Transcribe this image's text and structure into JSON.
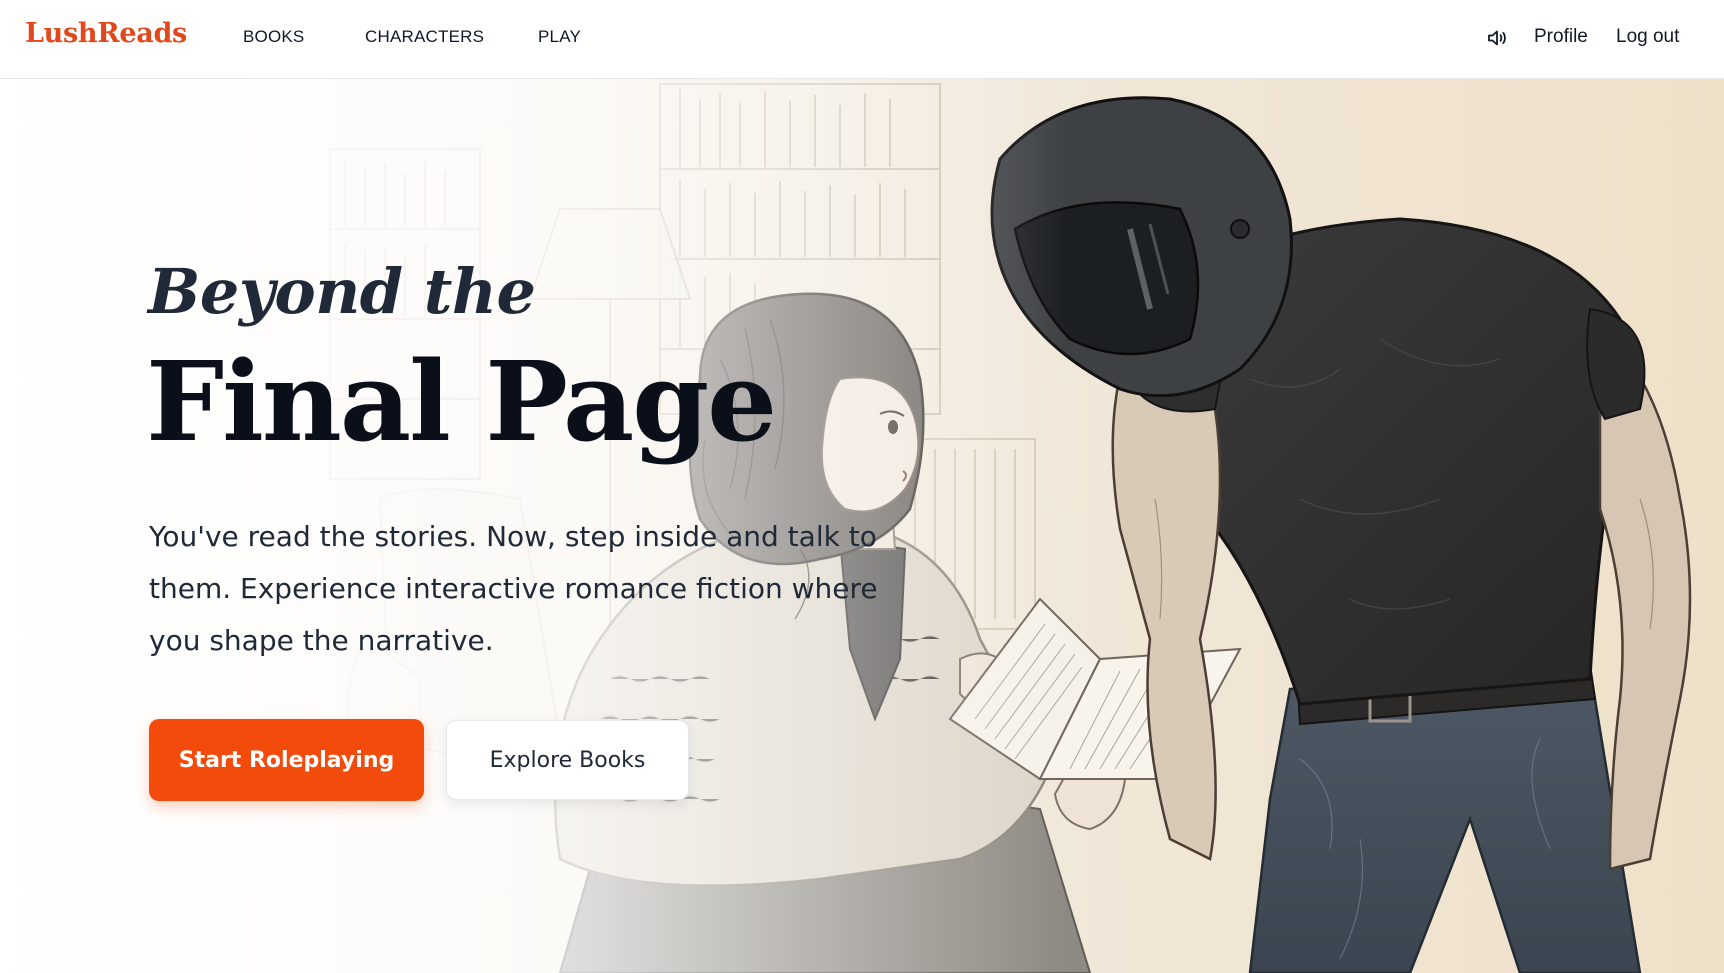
{
  "header": {
    "brand": "LushReads",
    "nav": {
      "books": "BOOKS",
      "characters": "CHARACTERS",
      "play": "PLAY"
    },
    "sound_icon": "speaker-icon",
    "profile": "Profile",
    "logout": "Log out"
  },
  "hero": {
    "headline_italic": "Beyond the",
    "headline_bold": "Final Page",
    "subtitle": "You've read the stories. Now, step inside and talk to them. Experience interactive romance fiction where you shape the narrative.",
    "primary_cta": "Start Roleplaying",
    "secondary_cta": "Explore Books"
  },
  "colors": {
    "brand": "#e2481b",
    "primary_button": "#f24b0c",
    "text_dark": "#0b0f19"
  }
}
